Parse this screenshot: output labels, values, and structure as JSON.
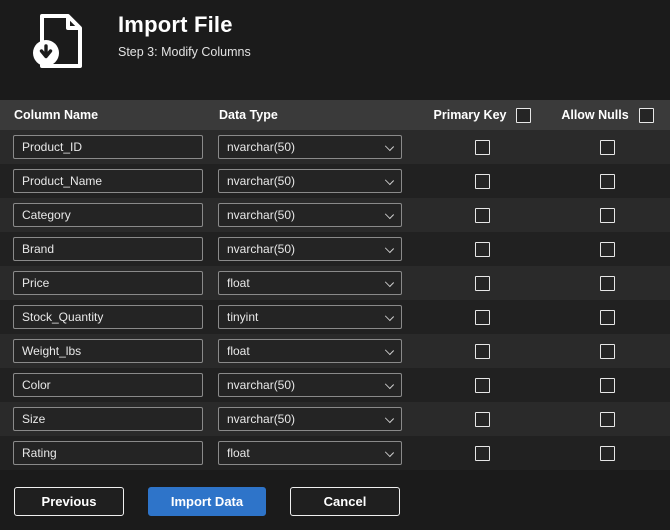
{
  "header": {
    "title": "Import File",
    "subtitle": "Step 3: Modify Columns"
  },
  "table": {
    "headers": {
      "column_name": "Column Name",
      "data_type": "Data Type",
      "primary_key": "Primary Key",
      "allow_nulls": "Allow Nulls"
    },
    "select_all": {
      "primary_key_checked": false,
      "allow_nulls_checked": false
    },
    "rows": [
      {
        "name": "Product_ID",
        "type": "nvarchar(50)",
        "primary_key": false,
        "allow_nulls": false
      },
      {
        "name": "Product_Name",
        "type": "nvarchar(50)",
        "primary_key": false,
        "allow_nulls": false
      },
      {
        "name": "Category",
        "type": "nvarchar(50)",
        "primary_key": false,
        "allow_nulls": false
      },
      {
        "name": "Brand",
        "type": "nvarchar(50)",
        "primary_key": false,
        "allow_nulls": false
      },
      {
        "name": "Price",
        "type": "float",
        "primary_key": false,
        "allow_nulls": false
      },
      {
        "name": "Stock_Quantity",
        "type": "tinyint",
        "primary_key": false,
        "allow_nulls": false
      },
      {
        "name": "Weight_lbs",
        "type": "float",
        "primary_key": false,
        "allow_nulls": false
      },
      {
        "name": "Color",
        "type": "nvarchar(50)",
        "primary_key": false,
        "allow_nulls": false
      },
      {
        "name": "Size",
        "type": "nvarchar(50)",
        "primary_key": false,
        "allow_nulls": false
      },
      {
        "name": "Rating",
        "type": "float",
        "primary_key": false,
        "allow_nulls": false
      }
    ]
  },
  "footer": {
    "previous_label": "Previous",
    "import_label": "Import Data",
    "cancel_label": "Cancel"
  },
  "colors": {
    "accent_blue": "#2e74c9",
    "table_header_bg": "#3a3a3a",
    "page_bg": "#1b1b1b"
  }
}
